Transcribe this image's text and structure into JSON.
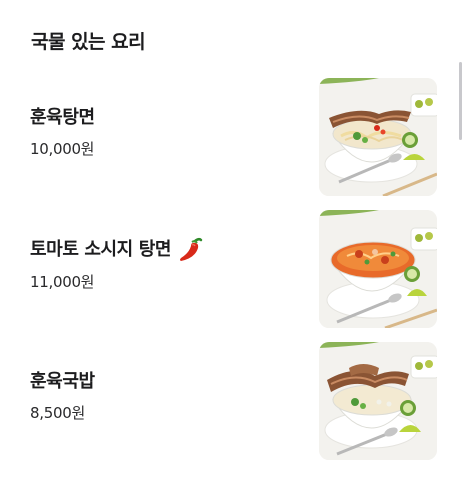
{
  "section": {
    "title": "국물 있는 요리"
  },
  "menu_items": [
    {
      "name": "훈육탕면",
      "price": "10,000원",
      "spicy": false,
      "image_icon": "noodle-soup-with-pork-image"
    },
    {
      "name": "토마토 소시지 탕면",
      "price": "11,000원",
      "spicy": true,
      "badge_icon": "chili-pepper-icon",
      "image_icon": "tomato-noodle-soup-image"
    },
    {
      "name": "훈육국밥",
      "price": "8,500원",
      "spicy": false,
      "image_icon": "pork-rice-soup-image"
    }
  ],
  "colors": {
    "accent_green": "#8cb458",
    "chili_red": "#d82a1a",
    "soup_red": "#e86a2a"
  }
}
